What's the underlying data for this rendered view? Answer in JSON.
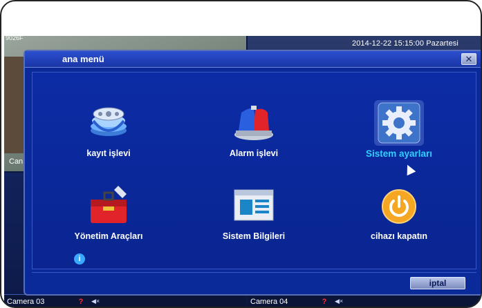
{
  "screen": {
    "corner_text": "9026F",
    "side_label": "Can",
    "datetime": "2014-12-22 15:15:00 Pazartesi",
    "cameras": [
      {
        "label": "Camera 03",
        "alert": "?",
        "speaker": "◀×"
      },
      {
        "label": "Camera 04",
        "alert": "?",
        "speaker": "◀×"
      }
    ]
  },
  "dialog": {
    "title": "ana menü",
    "close_glyph": "✕",
    "items": [
      {
        "label": "kayıt işlevi",
        "icon": "film-reel-icon",
        "selected": false
      },
      {
        "label": "Alarm işlevi",
        "icon": "alarm-siren-icon",
        "selected": false
      },
      {
        "label": "Sistem ayarları",
        "icon": "gear-icon",
        "selected": true
      },
      {
        "label": "Yönetim Araçları",
        "icon": "toolbox-icon",
        "selected": false
      },
      {
        "label": "Sistem Bilgileri",
        "icon": "system-info-icon",
        "selected": false
      },
      {
        "label": "cihazı kapatın",
        "icon": "power-icon",
        "selected": false
      }
    ],
    "info_glyph": "i",
    "cancel_label": "iptal"
  },
  "colors": {
    "dialog_bg": "#0a2a9a",
    "selected_label": "#2fd0ff",
    "alert": "#ff3030"
  }
}
